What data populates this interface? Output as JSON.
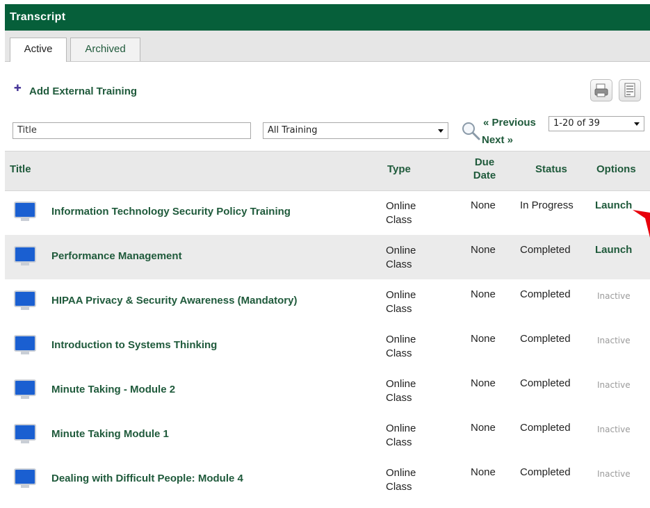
{
  "header": {
    "title": "Transcript"
  },
  "tabs": [
    {
      "label": "Active"
    },
    {
      "label": "Archived"
    }
  ],
  "toolbar": {
    "add_external_label": "Add External Training"
  },
  "filters": {
    "title_value": "Title",
    "training_selected": "All Training",
    "previous_label": "« Previous",
    "next_label": "Next »",
    "page_range": "1-20 of 39"
  },
  "table": {
    "headers": {
      "title": "Title",
      "type": "Type",
      "due": "Due Date",
      "status": "Status",
      "options": "Options"
    },
    "rows": [
      {
        "title": "Information Technology Security Policy Training",
        "type_line1": "Online",
        "type_line2": "Class",
        "due": "None",
        "status": "In Progress",
        "option": "Launch"
      },
      {
        "title": "Performance Management",
        "type_line1": "Online",
        "type_line2": "Class",
        "due": "None",
        "status": "Completed",
        "option": "Launch"
      },
      {
        "title": "HIPAA Privacy & Security Awareness (Mandatory)",
        "type_line1": "Online",
        "type_line2": "Class",
        "due": "None",
        "status": "Completed",
        "option": "Inactive"
      },
      {
        "title": "Introduction to Systems Thinking",
        "type_line1": "Online",
        "type_line2": "Class",
        "due": "None",
        "status": "Completed",
        "option": "Inactive"
      },
      {
        "title": "Minute Taking - Module 2",
        "type_line1": "Online",
        "type_line2": "Class",
        "due": "None",
        "status": "Completed",
        "option": "Inactive"
      },
      {
        "title": "Minute Taking Module 1",
        "type_line1": "Online",
        "type_line2": "Class",
        "due": "None",
        "status": "Completed",
        "option": "Inactive"
      },
      {
        "title": "Dealing with Difficult People: Module 4",
        "type_line1": "Online",
        "type_line2": "Class",
        "due": "None",
        "status": "Completed",
        "option": "Inactive"
      }
    ]
  },
  "colors": {
    "brand_green": "#065f3a",
    "link_green": "#1f5a3b",
    "arrow_red": "#e8000b"
  },
  "icons": {
    "row_icon": "monitor-icon",
    "print": "printer-icon",
    "export": "document-icon",
    "search": "magnifier-icon"
  }
}
